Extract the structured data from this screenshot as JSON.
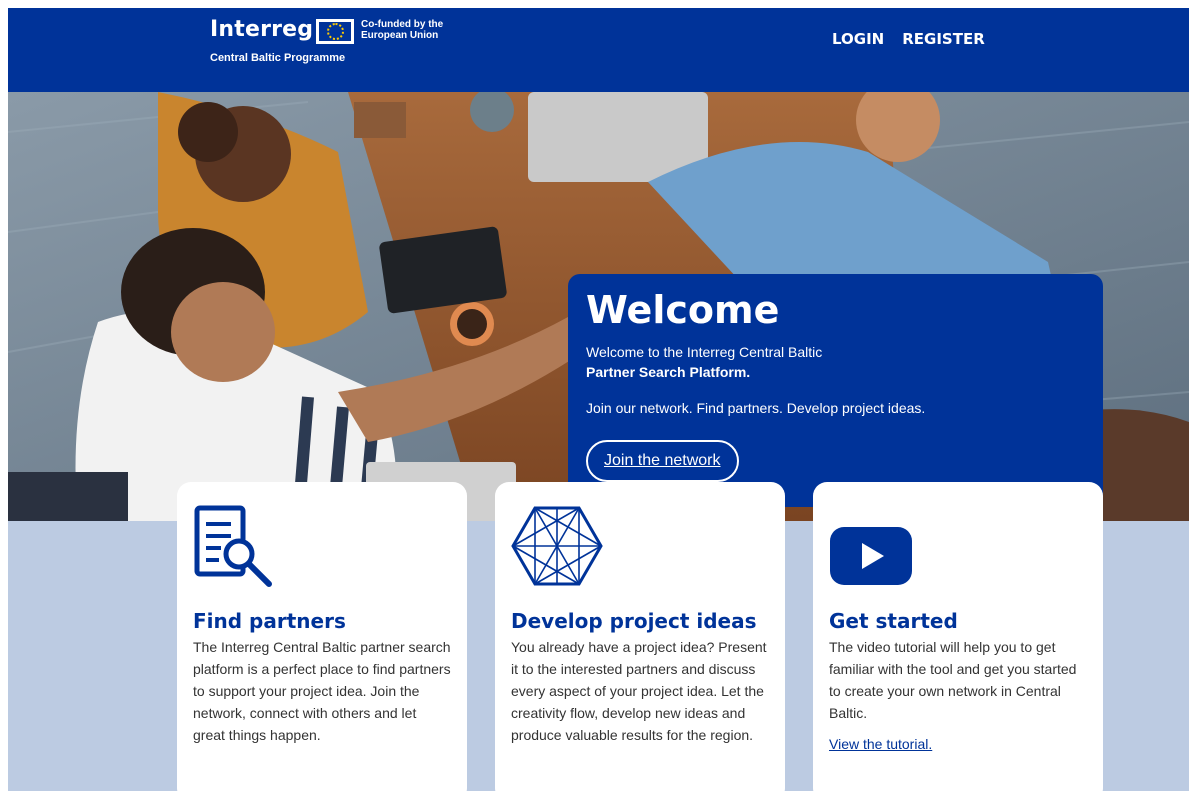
{
  "header": {
    "logo_text": "Interreg",
    "cofunded": "Co-funded by the European Union",
    "programme": "Central Baltic Programme",
    "nav": {
      "login": "LOGIN",
      "register": "REGISTER"
    }
  },
  "hero": {
    "title": "Welcome",
    "intro": "Welcome to the Interreg Central Baltic",
    "intro_strong": "Partner Search Platform.",
    "tagline": "Join our network. Find partners. Develop project ideas.",
    "cta": "Join the network"
  },
  "cards": [
    {
      "icon": "document-search-icon",
      "title": "Find partners",
      "body": "The Interreg Central Baltic partner search platform is a perfect place to find partners to support your project idea. Join the network, connect with others and let great things happen."
    },
    {
      "icon": "network-hexagon-icon",
      "title": "Develop project ideas",
      "body": "You already have a project idea? Present it to the interested partners and discuss every aspect of your project idea. Let the creativity flow, develop new ideas and produce valuable results for the region."
    },
    {
      "icon": "play-video-icon",
      "title": "Get started",
      "body": "The video tutorial will help you to get familiar with the tool and get you started to create your own network in Central Baltic.",
      "link": "View the tutorial."
    }
  ],
  "colors": {
    "brand": "#003399",
    "background": "#bccbe2"
  }
}
